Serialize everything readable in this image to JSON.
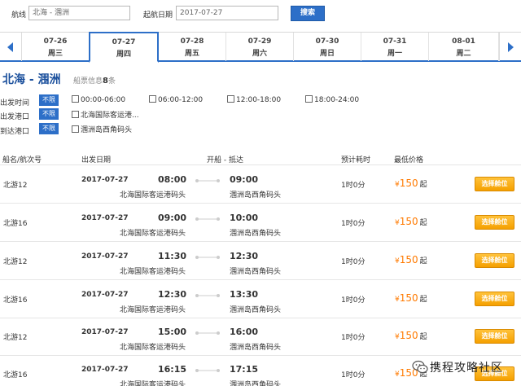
{
  "search": {
    "route_label": "航线",
    "route_value": "北海 - 涠洲",
    "date_label": "起航日期",
    "date_value": "2017-07-27",
    "button": "搜索"
  },
  "dates": [
    {
      "date": "07-26",
      "weekday": "周三",
      "active": false
    },
    {
      "date": "07-27",
      "weekday": "周四",
      "active": true
    },
    {
      "date": "07-28",
      "weekday": "周五",
      "active": false
    },
    {
      "date": "07-29",
      "weekday": "周六",
      "active": false
    },
    {
      "date": "07-30",
      "weekday": "周日",
      "active": false
    },
    {
      "date": "07-31",
      "weekday": "周一",
      "active": false
    },
    {
      "date": "08-01",
      "weekday": "周二",
      "active": false
    }
  ],
  "route": {
    "title": "北海 - 涠洲",
    "info_label": "船票信息",
    "count": "8",
    "unit": "条"
  },
  "filters": [
    {
      "label": "出发时间",
      "tag": "不限",
      "options": [
        "00:00-06:00",
        "06:00-12:00",
        "12:00-18:00",
        "18:00-24:00"
      ]
    },
    {
      "label": "出发港口",
      "tag": "不限",
      "options": [
        "北海国际客运港..."
      ]
    },
    {
      "label": "到达港口",
      "tag": "不限",
      "options": [
        "涠洲岛西角码头"
      ]
    }
  ],
  "table_headers": {
    "ship": "船名/航次号",
    "date": "出发日期",
    "route": "开船 - 抵达",
    "duration": "预计耗时",
    "price": "最低价格"
  },
  "sailings": [
    {
      "ship": "北游12",
      "date": "2017-07-27",
      "depart": "08:00",
      "arrive": "09:00",
      "from": "北海国际客运港码头",
      "to": "涠洲岛西角码头",
      "duration": "1时0分",
      "currency": "¥",
      "price": "150",
      "suffix": "起",
      "button": "选择舱位"
    },
    {
      "ship": "北游16",
      "date": "2017-07-27",
      "depart": "09:00",
      "arrive": "10:00",
      "from": "北海国际客运港码头",
      "to": "涠洲岛西角码头",
      "duration": "1时0分",
      "currency": "¥",
      "price": "150",
      "suffix": "起",
      "button": "选择舱位"
    },
    {
      "ship": "北游12",
      "date": "2017-07-27",
      "depart": "11:30",
      "arrive": "12:30",
      "from": "北海国际客运港码头",
      "to": "涠洲岛西角码头",
      "duration": "1时0分",
      "currency": "¥",
      "price": "150",
      "suffix": "起",
      "button": "选择舱位"
    },
    {
      "ship": "北游16",
      "date": "2017-07-27",
      "depart": "12:30",
      "arrive": "13:30",
      "from": "北海国际客运港码头",
      "to": "涠洲岛西角码头",
      "duration": "1时0分",
      "currency": "¥",
      "price": "150",
      "suffix": "起",
      "button": "选择舱位"
    },
    {
      "ship": "北游12",
      "date": "2017-07-27",
      "depart": "15:00",
      "arrive": "16:00",
      "from": "北海国际客运港码头",
      "to": "涠洲岛西角码头",
      "duration": "1时0分",
      "currency": "¥",
      "price": "150",
      "suffix": "起",
      "button": "选择舱位"
    },
    {
      "ship": "北游16",
      "date": "2017-07-27",
      "depart": "16:15",
      "arrive": "17:15",
      "from": "北海国际客运港码头",
      "to": "涠洲岛西角码头",
      "duration": "1时0分",
      "currency": "¥",
      "price": "150",
      "suffix": "起",
      "button": "选择舱位"
    }
  ],
  "watermark": "携程攻略社区",
  "colors": {
    "accent": "#2d6fc8",
    "price": "#ff7a00",
    "select_button": "#f5a000"
  }
}
